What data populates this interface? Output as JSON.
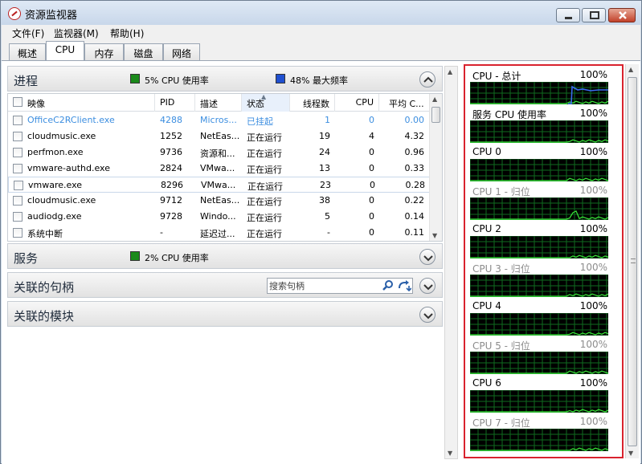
{
  "window": {
    "title": "资源监视器"
  },
  "menu": [
    "文件(F)",
    "监视器(M)",
    "帮助(H)"
  ],
  "tabs": [
    "概述",
    "CPU",
    "内存",
    "磁盘",
    "网络"
  ],
  "active_tab": "CPU",
  "processes": {
    "title": "进程",
    "cpu_usage": "5% CPU 使用率",
    "max_freq": "48% 最大频率",
    "columns": [
      "映像",
      "PID",
      "描述",
      "状态",
      "线程数",
      "CPU",
      "平均 C..."
    ],
    "sorted_column": "状态",
    "rows": [
      {
        "image": "OfficeC2RClient.exe",
        "pid": "4288",
        "desc": "Micros...",
        "status": "已挂起",
        "threads": "1",
        "cpu": "0",
        "avg": "0.00",
        "style": "suspended"
      },
      {
        "image": "cloudmusic.exe",
        "pid": "1252",
        "desc": "NetEas...",
        "status": "正在运行",
        "threads": "19",
        "cpu": "4",
        "avg": "4.32",
        "style": ""
      },
      {
        "image": "perfmon.exe",
        "pid": "9736",
        "desc": "资源和...",
        "status": "正在运行",
        "threads": "24",
        "cpu": "0",
        "avg": "0.96",
        "style": ""
      },
      {
        "image": "vmware-authd.exe",
        "pid": "2824",
        "desc": "VMwa...",
        "status": "正在运行",
        "threads": "13",
        "cpu": "0",
        "avg": "0.33",
        "style": ""
      },
      {
        "image": "vmware.exe",
        "pid": "8296",
        "desc": "VMwa...",
        "status": "正在运行",
        "threads": "23",
        "cpu": "0",
        "avg": "0.28",
        "style": "selected"
      },
      {
        "image": "cloudmusic.exe",
        "pid": "9712",
        "desc": "NetEas...",
        "status": "正在运行",
        "threads": "38",
        "cpu": "0",
        "avg": "0.22",
        "style": ""
      },
      {
        "image": "audiodg.exe",
        "pid": "9728",
        "desc": "Windo...",
        "status": "正在运行",
        "threads": "5",
        "cpu": "0",
        "avg": "0.14",
        "style": ""
      },
      {
        "image": "系统中断",
        "pid": "-",
        "desc": "延迟过...",
        "status": "正在运行",
        "threads": "-",
        "cpu": "0",
        "avg": "0.11",
        "style": ""
      }
    ]
  },
  "services": {
    "title": "服务",
    "cpu_usage": "2% CPU 使用率"
  },
  "handles": {
    "title": "关联的句柄",
    "search_placeholder": "搜索句柄"
  },
  "modules": {
    "title": "关联的模块"
  },
  "graphs": [
    {
      "label": "CPU - 总计",
      "pct": "100%",
      "dim": false
    },
    {
      "label": "服务 CPU 使用率",
      "pct": "100%",
      "dim": false
    },
    {
      "label": "CPU 0",
      "pct": "100%",
      "dim": false
    },
    {
      "label": "CPU 1 - 归位",
      "pct": "100%",
      "dim": true
    },
    {
      "label": "CPU 2",
      "pct": "100%",
      "dim": false
    },
    {
      "label": "CPU 3 - 归位",
      "pct": "100%",
      "dim": true
    },
    {
      "label": "CPU 4",
      "pct": "100%",
      "dim": false
    },
    {
      "label": "CPU 5 - 归位",
      "pct": "100%",
      "dim": true
    },
    {
      "label": "CPU 6",
      "pct": "100%",
      "dim": false
    },
    {
      "label": "CPU 7 - 归位",
      "pct": "100%",
      "dim": true
    }
  ],
  "colors": {
    "graph_grid": "#0f6b1f",
    "graph_line": "#39e639",
    "graph_blue": "#3a6df0",
    "highlight_border": "#d9232e",
    "suspended_text": "#3c8ee0"
  }
}
